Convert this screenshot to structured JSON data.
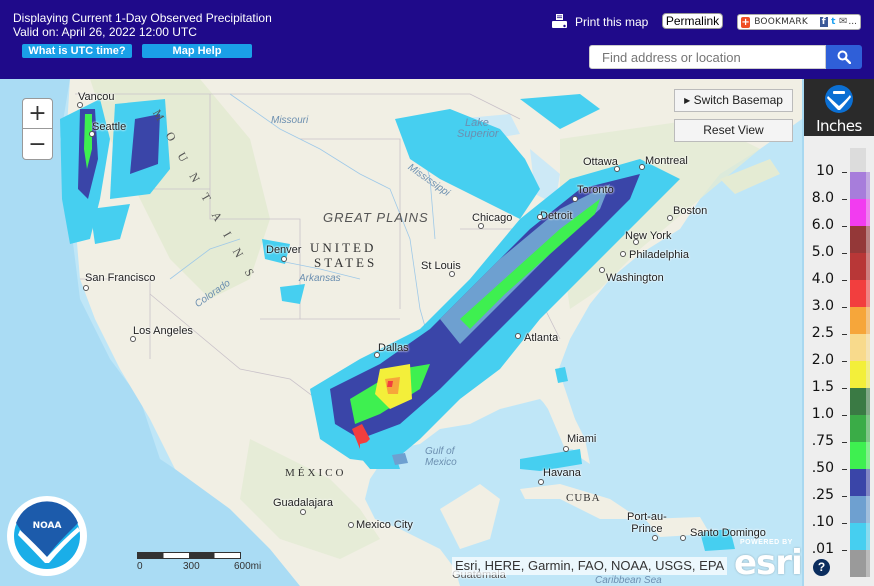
{
  "header": {
    "title_line": "Displaying Current 1-Day Observed Precipitation",
    "valid_line": "Valid on: April 26, 2022 12:00 UTC",
    "utc_button": "What is UTC time?",
    "help_button": "Map Help",
    "print_label": "Print this map",
    "permalink_label": "Permalink",
    "bookmark_label": "BOOKMARK",
    "bookmark_more": "...",
    "search_placeholder": "Find address or location"
  },
  "map": {
    "switch_basemap_label": "Switch Basemap",
    "reset_view_label": "Reset View",
    "zoom_in": "+",
    "zoom_out": "−",
    "cities": [
      {
        "name": "Vancouver",
        "label": "Vancou"
      },
      {
        "name": "Seattle",
        "label": "Seattle"
      },
      {
        "name": "San Francisco",
        "label": "San Francisco"
      },
      {
        "name": "Los Angeles",
        "label": "Los Angeles"
      },
      {
        "name": "Denver",
        "label": "Denver"
      },
      {
        "name": "St Louis",
        "label": "St Louis"
      },
      {
        "name": "Chicago",
        "label": "Chicago"
      },
      {
        "name": "Detroit",
        "label": "Detroit"
      },
      {
        "name": "Toronto",
        "label": "Toronto"
      },
      {
        "name": "Ottawa",
        "label": "Ottawa"
      },
      {
        "name": "Montreal",
        "label": "Montreal"
      },
      {
        "name": "Boston",
        "label": "Boston"
      },
      {
        "name": "New York",
        "label": "New York"
      },
      {
        "name": "Philadelphia",
        "label": "Philadelphia"
      },
      {
        "name": "Washington",
        "label": "Washington"
      },
      {
        "name": "Atlanta",
        "label": "Atlanta"
      },
      {
        "name": "Dallas",
        "label": "Dallas"
      },
      {
        "name": "Miami",
        "label": "Miami"
      },
      {
        "name": "Havana",
        "label": "Havana"
      },
      {
        "name": "Port-au-Prince",
        "label": "Port-au-\nPrince"
      },
      {
        "name": "Santo Domingo",
        "label": "Santo Domingo"
      },
      {
        "name": "Guadalajara",
        "label": "Guadalajara"
      },
      {
        "name": "Mexico City",
        "label": "Mexico City"
      },
      {
        "name": "Guatemala",
        "label": "Guatemala"
      }
    ],
    "regions": {
      "rocky_mountains": "M O U N T A I N S",
      "great_plains": "GREAT PLAINS",
      "us_line1": "UNITED",
      "us_line2": "STATES",
      "mexico": "MÉXICO",
      "cuba": "CUBA"
    },
    "water_labels": {
      "missouri": "Missouri",
      "mississippi": "Mississippi",
      "lake_superior_1": "Lake",
      "lake_superior_2": "Superior",
      "arkansas": "Arkansas",
      "colorado": "Colorado",
      "gulf_1": "Gulf of",
      "gulf_2": "Mexico",
      "caribbean": "Caribbean Sea"
    },
    "scale": {
      "zero": "0",
      "mid": "300",
      "end": "600mi"
    },
    "attribution": "Esri, HERE, Garmin, FAO, NOAA, USGS, EPA",
    "esri_powered": "POWERED BY",
    "esri_name": "esri",
    "noaa_logo_text": "NOAA"
  },
  "legend": {
    "unit": "Inches",
    "help": "?",
    "entries": [
      {
        "label": "10",
        "color": "#a77ddb"
      },
      {
        "label": "8.0",
        "color": "#f23cf0"
      },
      {
        "label": "6.0",
        "color": "#943838"
      },
      {
        "label": "5.0",
        "color": "#b83737"
      },
      {
        "label": "4.0",
        "color": "#f23e3e"
      },
      {
        "label": "3.0",
        "color": "#f6a63a"
      },
      {
        "label": "2.5",
        "color": "#f8da8c"
      },
      {
        "label": "2.0",
        "color": "#f3ef3a"
      },
      {
        "label": "1.5",
        "color": "#3a7a44"
      },
      {
        "label": "1.0",
        "color": "#3aac47"
      },
      {
        "label": ".75",
        "color": "#3ef050"
      },
      {
        "label": ".50",
        "color": "#3a45a8"
      },
      {
        "label": ".25",
        "color": "#6ea0d0"
      },
      {
        "label": ".10",
        "color": "#46cff0"
      },
      {
        "label": ".01",
        "color": "#9a9a9a"
      }
    ],
    "top_color": "#dcdcdc"
  }
}
